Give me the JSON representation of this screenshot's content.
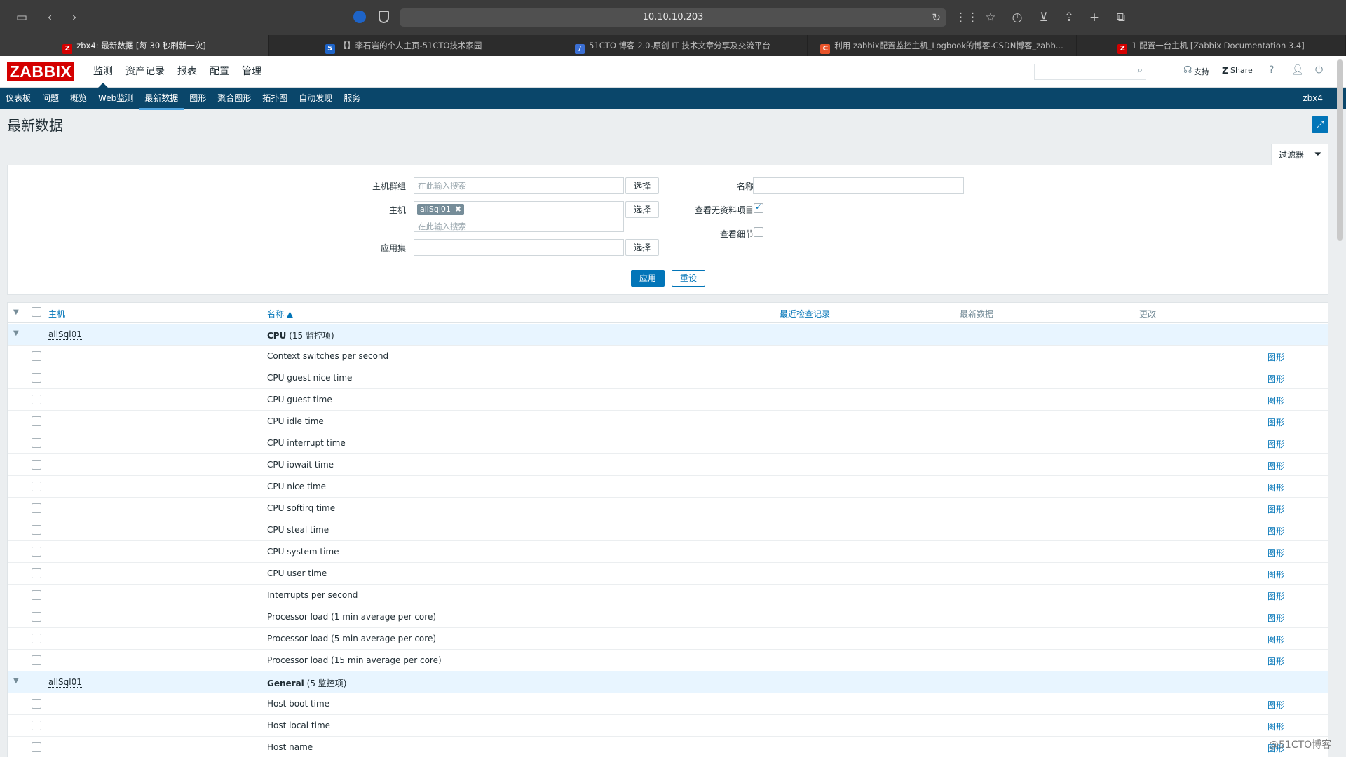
{
  "browser": {
    "url": "10.10.10.203",
    "tabs": [
      {
        "label": "zbx4: 最新数据 [每 30 秒刷新一次]",
        "favicon": "Z",
        "color": "#d40000"
      },
      {
        "label": "【】李石岩的个人主页-51CTO技术家园",
        "favicon": "5",
        "color": "#1e64c8"
      },
      {
        "label": "51CTO 博客 2.0-原创 IT 技术文章分享及交流平台",
        "favicon": "/",
        "color": "#3b6fd4"
      },
      {
        "label": "利用 zabbix配置监控主机_Logbook的博客-CSDN博客_zabb...",
        "favicon": "C",
        "color": "#e8542a"
      },
      {
        "label": "1 配置一台主机 [Zabbix Documentation 3.4]",
        "favicon": "Z",
        "color": "#d40000"
      }
    ]
  },
  "header": {
    "logo": "ZABBIX",
    "menu": [
      "监测",
      "资产记录",
      "报表",
      "配置",
      "管理"
    ],
    "support": "支持",
    "share": "Share",
    "help": "?"
  },
  "subnav": {
    "items": [
      "仪表板",
      "问题",
      "概览",
      "Web监测",
      "最新数据",
      "图形",
      "聚合图形",
      "拓扑图",
      "自动发现",
      "服务"
    ],
    "server": "zbx4"
  },
  "page": {
    "title": "最新数据"
  },
  "filter": {
    "tab_label": "过滤器",
    "hostgroup_label": "主机群组",
    "hostgroup_placeholder": "在此输入搜索",
    "host_label": "主机",
    "host_chip": "allSql01",
    "host_placeholder": "在此输入搜索",
    "app_label": "应用集",
    "select": "选择",
    "name_label": "名称",
    "show_nodata_label": "查看无资料项目",
    "show_details_label": "查看细节",
    "apply": "应用",
    "reset": "重设"
  },
  "table": {
    "columns": {
      "host": "主机",
      "name": "名称 ▲",
      "last_check": "最近检查记录",
      "last_value": "最新数据",
      "change": "更改"
    },
    "graph_label": "图形",
    "groups": [
      {
        "host": "allSql01",
        "app": "CPU",
        "count": "(15 监控项)",
        "items": [
          "Context switches per second",
          "CPU guest nice time",
          "CPU guest time",
          "CPU idle time",
          "CPU interrupt time",
          "CPU iowait time",
          "CPU nice time",
          "CPU softirq time",
          "CPU steal time",
          "CPU system time",
          "CPU user time",
          "Interrupts per second",
          "Processor load (1 min average per core)",
          "Processor load (5 min average per core)",
          "Processor load (15 min average per core)"
        ]
      },
      {
        "host": "allSql01",
        "app": "General",
        "count": "(5 监控项)",
        "items": [
          "Host boot time",
          "Host local time",
          "Host name"
        ]
      }
    ]
  },
  "watermark": "@51CTO博客"
}
